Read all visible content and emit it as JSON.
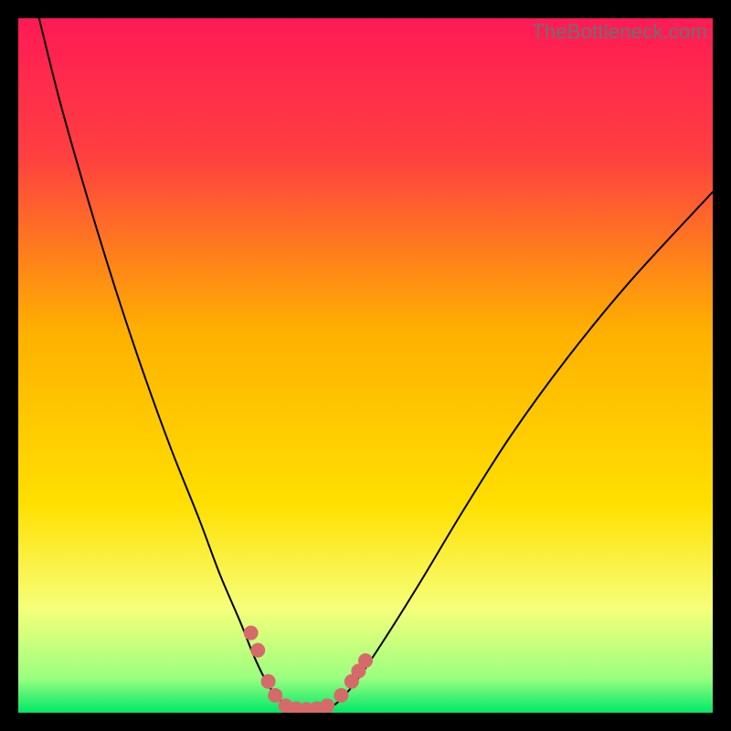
{
  "watermark": "TheBottleneck.com",
  "chart_data": {
    "type": "line",
    "title": "",
    "xlabel": "",
    "ylabel": "",
    "xlim": [
      0,
      100
    ],
    "ylim": [
      0,
      100
    ],
    "background_gradient": {
      "stops": [
        {
          "offset": 0,
          "color": "#ff1a55"
        },
        {
          "offset": 20,
          "color": "#ff4040"
        },
        {
          "offset": 45,
          "color": "#ffb000"
        },
        {
          "offset": 70,
          "color": "#ffe000"
        },
        {
          "offset": 85,
          "color": "#f6ff7a"
        },
        {
          "offset": 95,
          "color": "#9bff80"
        },
        {
          "offset": 100,
          "color": "#00e868"
        }
      ]
    },
    "series": [
      {
        "name": "left-curve",
        "color": "#000000",
        "width": 2,
        "points": [
          {
            "x": 3,
            "y": 100
          },
          {
            "x": 6,
            "y": 88
          },
          {
            "x": 10,
            "y": 74
          },
          {
            "x": 14,
            "y": 61
          },
          {
            "x": 18,
            "y": 49
          },
          {
            "x": 22,
            "y": 38
          },
          {
            "x": 26,
            "y": 28
          },
          {
            "x": 29,
            "y": 20
          },
          {
            "x": 32,
            "y": 13
          },
          {
            "x": 34,
            "y": 8
          },
          {
            "x": 36,
            "y": 4
          },
          {
            "x": 38,
            "y": 1.5
          },
          {
            "x": 40,
            "y": 0.5
          }
        ]
      },
      {
        "name": "right-curve",
        "color": "#000000",
        "width": 2,
        "points": [
          {
            "x": 44,
            "y": 0.5
          },
          {
            "x": 46,
            "y": 1.5
          },
          {
            "x": 49,
            "y": 5
          },
          {
            "x": 53,
            "y": 11
          },
          {
            "x": 58,
            "y": 19
          },
          {
            "x": 64,
            "y": 29
          },
          {
            "x": 71,
            "y": 40
          },
          {
            "x": 79,
            "y": 51
          },
          {
            "x": 88,
            "y": 62
          },
          {
            "x": 100,
            "y": 75
          }
        ]
      },
      {
        "name": "marker-dots",
        "color": "#d66a6a",
        "type": "scatter",
        "radius": 8,
        "points": [
          {
            "x": 33.5,
            "y": 11.5
          },
          {
            "x": 34.5,
            "y": 9
          },
          {
            "x": 36,
            "y": 4.5
          },
          {
            "x": 37,
            "y": 2.5
          },
          {
            "x": 38.5,
            "y": 1
          },
          {
            "x": 40,
            "y": 0.6
          },
          {
            "x": 41.5,
            "y": 0.5
          },
          {
            "x": 43,
            "y": 0.6
          },
          {
            "x": 44.5,
            "y": 1
          },
          {
            "x": 46.5,
            "y": 2.5
          },
          {
            "x": 48,
            "y": 4.5
          },
          {
            "x": 49,
            "y": 6
          },
          {
            "x": 50,
            "y": 7.5
          }
        ]
      }
    ]
  }
}
